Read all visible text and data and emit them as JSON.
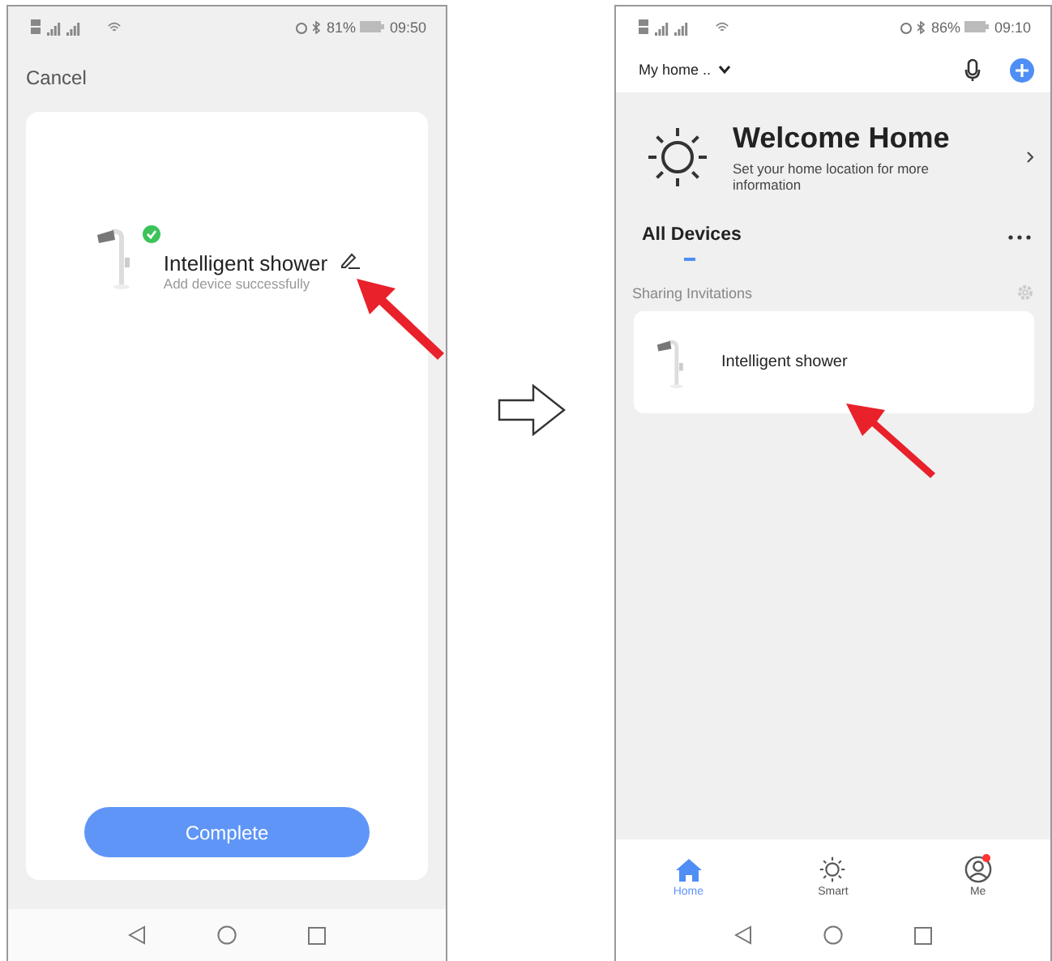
{
  "left_screen": {
    "status": {
      "battery": "81%",
      "time": "09:50"
    },
    "cancel": "Cancel",
    "device": {
      "name": "Intelligent shower",
      "note": "Add device successfully",
      "added": true
    },
    "complete_button": "Complete"
  },
  "right_screen": {
    "status": {
      "battery": "86%",
      "time": "09:10"
    },
    "home_selector": "My home ..",
    "welcome": {
      "title": "Welcome Home",
      "subtitle": "Set your home location for more information"
    },
    "section_title": "All Devices",
    "sharing_label": "Sharing Invitations",
    "devices": [
      {
        "name": "Intelligent shower"
      }
    ],
    "tabs": [
      {
        "label": "Home",
        "selected": true,
        "kind": "home"
      },
      {
        "label": "Smart",
        "selected": false,
        "kind": "smart"
      },
      {
        "label": "Me",
        "selected": false,
        "kind": "me",
        "badge": true
      }
    ]
  }
}
